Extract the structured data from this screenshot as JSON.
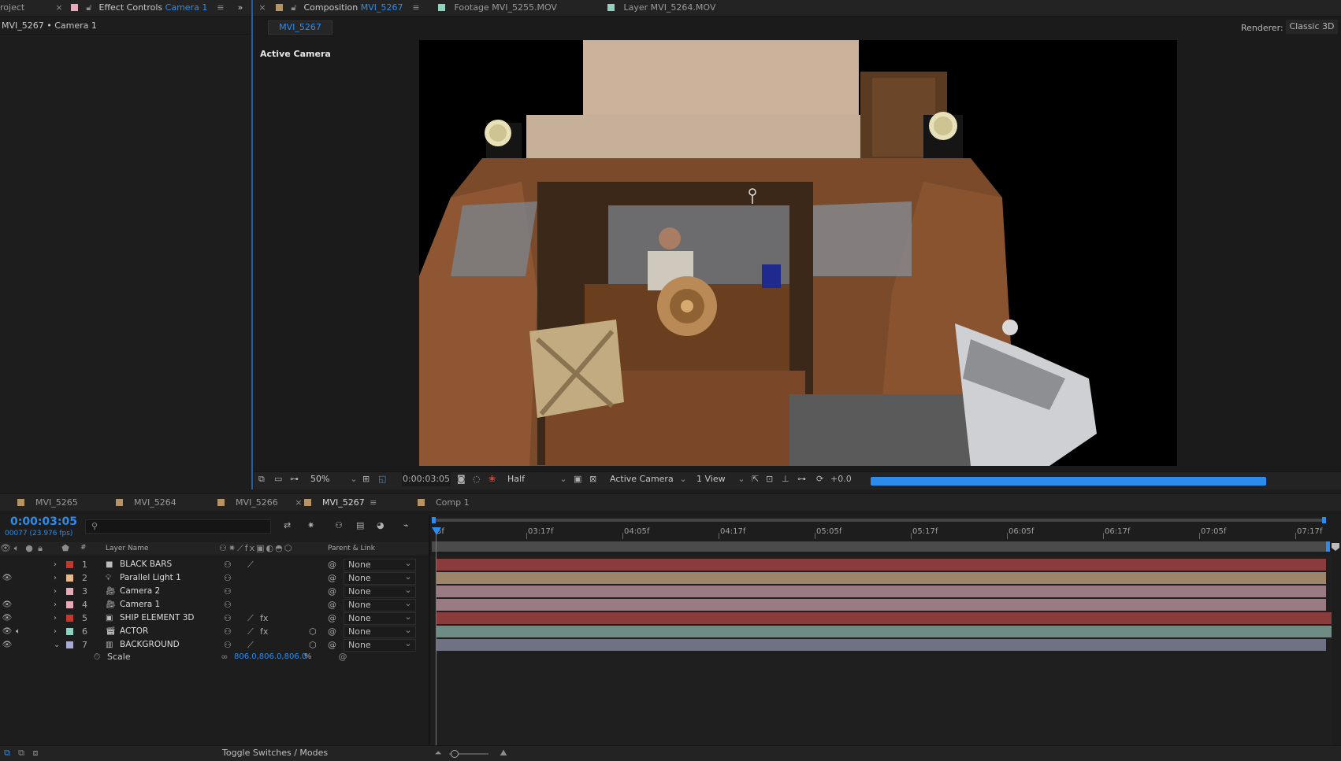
{
  "top_tabs": {
    "project": "roject",
    "effect_controls_prefix": "Effect Controls",
    "effect_controls_layer": "Camera 1",
    "composition_prefix": "Composition",
    "composition_name": "MVI_5267",
    "footage_prefix": "Footage",
    "footage_name": "MVI_5255.MOV",
    "layer_prefix": "Layer",
    "layer_name": "MVI_5264.MOV"
  },
  "effect_controls": {
    "subtitle": "MVI_5267 • Camera 1"
  },
  "comp_viewer": {
    "flowchart_tab": "MVI_5267",
    "renderer_label": "Renderer:",
    "renderer_value": "Classic 3D",
    "view_label": "Active Camera"
  },
  "viewer_toolbar": {
    "zoom": "50%",
    "timecode": "0:00:03:05",
    "resolution": "Half",
    "camera_view": "Active Camera",
    "views": "1 View",
    "exposure": "+0.0",
    "progress": 0.88
  },
  "timeline_tabs": [
    "MVI_5265",
    "MVI_5264",
    "MVI_5266",
    "MVI_5267",
    "Comp 1"
  ],
  "timeline_tab_colors": [
    "#b69463",
    "#b69463",
    "#b69463",
    "#b69463",
    "#b69463"
  ],
  "timeline": {
    "current_time": "0:00:03:05",
    "frame_info": "00077 (23.976 fps)",
    "search_placeholder": "",
    "col_layer_name": "Layer Name",
    "col_num": "#",
    "col_parent": "Parent & Link",
    "ruler_labels": [
      "5f",
      "03:17f",
      "04:05f",
      "04:17f",
      "05:05f",
      "05:17f",
      "06:05f",
      "06:17f",
      "07:05f",
      "07:17f"
    ],
    "toggle_label": "Toggle Switches / Modes",
    "property_name": "Scale",
    "property_value": "806.0,806.0,806.0",
    "property_unit": "%"
  },
  "layers": [
    {
      "num": "1",
      "name": "BLACK BARS",
      "label_color": "#c0392b",
      "type_icon": "solid-icon",
      "parent": "None",
      "eye": false,
      "audio": false,
      "bar_color": "#8a3b3b",
      "fx": false,
      "pen": true
    },
    {
      "num": "2",
      "name": "Parallel Light 1",
      "label_color": "#e3b98d",
      "type_icon": "light-icon",
      "parent": "None",
      "eye": true,
      "audio": false,
      "bar_color": "#9e8468",
      "fx": false,
      "pen": false
    },
    {
      "num": "3",
      "name": "Camera 2",
      "label_color": "#e6a9b8",
      "type_icon": "camera-icon",
      "parent": "None",
      "eye": false,
      "audio": false,
      "bar_color": "#9a7a83",
      "fx": false,
      "pen": false
    },
    {
      "num": "4",
      "name": "Camera 1",
      "label_color": "#e6a9b8",
      "type_icon": "camera-icon",
      "parent": "None",
      "eye": true,
      "audio": false,
      "bar_color": "#9a7a83",
      "fx": false,
      "pen": false
    },
    {
      "num": "5",
      "name": "SHIP ELEMENT 3D",
      "label_color": "#c0392b",
      "type_icon": "precomp-icon",
      "parent": "None",
      "eye": true,
      "audio": false,
      "bar_color": "#8a3b3b",
      "fx": true,
      "pen": true
    },
    {
      "num": "6",
      "name": "ACTOR",
      "label_color": "#8fd1be",
      "type_icon": "footage-icon",
      "parent": "None",
      "eye": true,
      "audio": true,
      "bar_color": "#6f8c84",
      "fx": true,
      "pen": true
    },
    {
      "num": "7",
      "name": "BACKGROUND",
      "label_color": "#a9aad6",
      "type_icon": "image-icon",
      "parent": "None",
      "eye": true,
      "audio": false,
      "bar_color": "#6f7282",
      "fx": false,
      "pen": true
    }
  ]
}
